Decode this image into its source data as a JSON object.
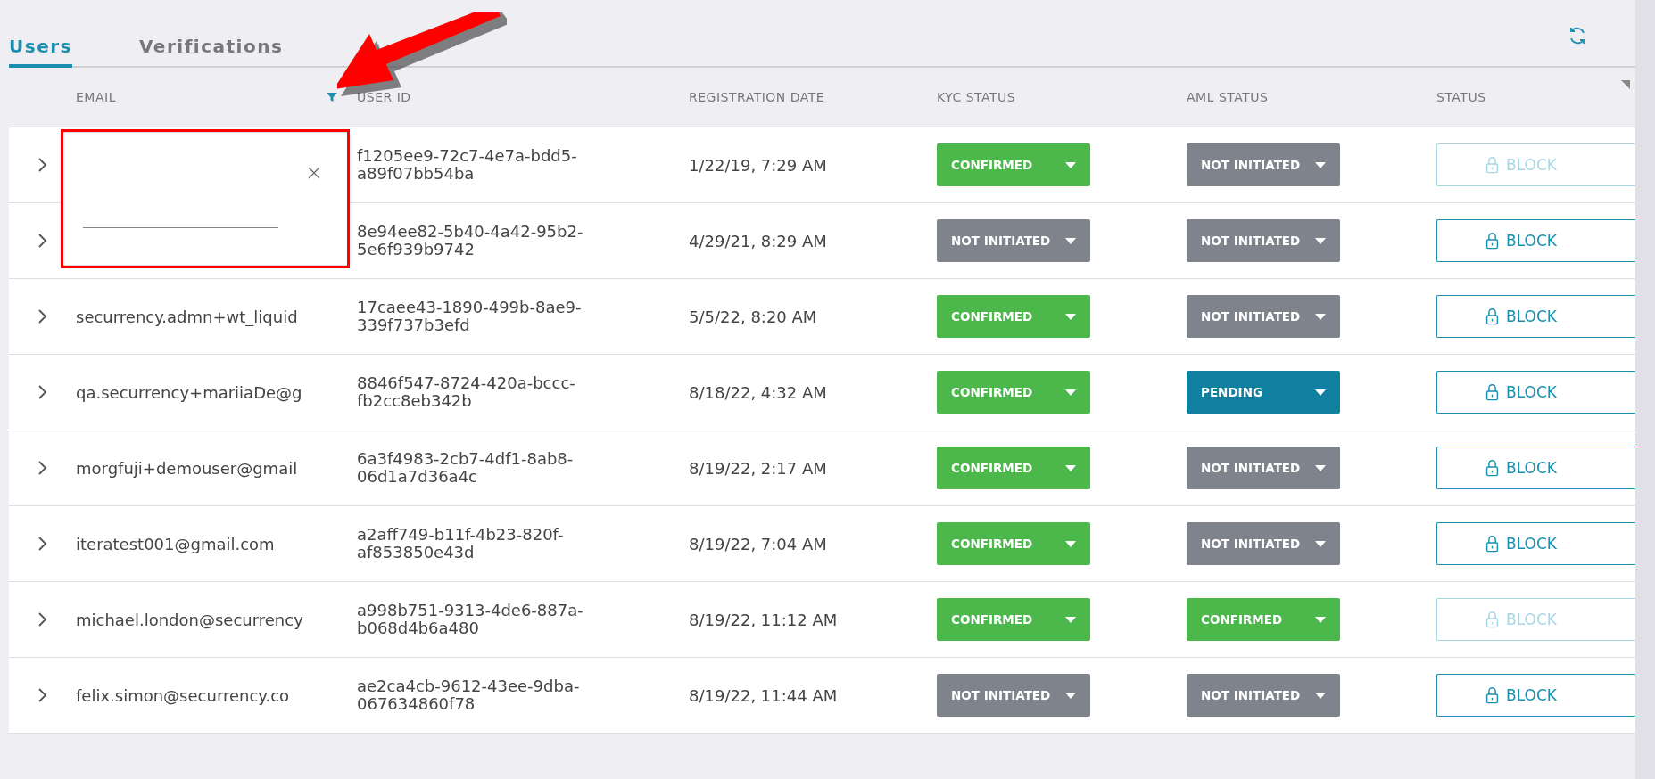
{
  "tabs": [
    {
      "label": "Users",
      "selected": true
    },
    {
      "label": "Verifications",
      "selected": false
    }
  ],
  "table": {
    "columns": [
      "EMAIL",
      "USER ID",
      "REGISTRATION DATE",
      "KYC STATUS",
      "AML STATUS",
      "STATUS"
    ],
    "rows": [
      {
        "email": "",
        "user_id": "f1205ee9-72c7-4e7a-bdd5-a89f07bb54ba",
        "registered": "1/22/19, 7:29 AM",
        "kyc": {
          "label": "CONFIRMED",
          "kind": "confirmed"
        },
        "aml": {
          "label": "NOT INITIATED",
          "kind": "not_initiated"
        },
        "action": {
          "label": "BLOCK",
          "disabled": true
        }
      },
      {
        "email": "",
        "user_id": "8e94ee82-5b40-4a42-95b2-5e6f939b9742",
        "registered": "4/29/21, 8:29 AM",
        "kyc": {
          "label": "NOT INITIATED",
          "kind": "not_initiated"
        },
        "aml": {
          "label": "NOT INITIATED",
          "kind": "not_initiated"
        },
        "action": {
          "label": "BLOCK",
          "disabled": false
        }
      },
      {
        "email": "securrency.admn+wt_liquid",
        "user_id": "17caee43-1890-499b-8ae9-339f737b3efd",
        "registered": "5/5/22, 8:20 AM",
        "kyc": {
          "label": "CONFIRMED",
          "kind": "confirmed"
        },
        "aml": {
          "label": "NOT INITIATED",
          "kind": "not_initiated"
        },
        "action": {
          "label": "BLOCK",
          "disabled": false
        }
      },
      {
        "email": "qa.securrency+mariiaDe@g",
        "user_id": "8846f547-8724-420a-bccc-fb2cc8eb342b",
        "registered": "8/18/22, 4:32 AM",
        "kyc": {
          "label": "CONFIRMED",
          "kind": "confirmed"
        },
        "aml": {
          "label": "PENDING",
          "kind": "pending"
        },
        "action": {
          "label": "BLOCK",
          "disabled": false
        }
      },
      {
        "email": "morgfuji+demouser@gmail",
        "user_id": "6a3f4983-2cb7-4df1-8ab8-06d1a7d36a4c",
        "registered": "8/19/22, 2:17 AM",
        "kyc": {
          "label": "CONFIRMED",
          "kind": "confirmed"
        },
        "aml": {
          "label": "NOT INITIATED",
          "kind": "not_initiated"
        },
        "action": {
          "label": "BLOCK",
          "disabled": false
        }
      },
      {
        "email": "iteratest001@gmail.com",
        "user_id": "a2aff749-b11f-4b23-820f-af853850e43d",
        "registered": "8/19/22, 7:04 AM",
        "kyc": {
          "label": "CONFIRMED",
          "kind": "confirmed"
        },
        "aml": {
          "label": "NOT INITIATED",
          "kind": "not_initiated"
        },
        "action": {
          "label": "BLOCK",
          "disabled": false
        }
      },
      {
        "email": "michael.london@securrency",
        "user_id": "a998b751-9313-4de6-887a-b068d4b6a480",
        "registered": "8/19/22, 11:12 AM",
        "kyc": {
          "label": "CONFIRMED",
          "kind": "confirmed"
        },
        "aml": {
          "label": "CONFIRMED",
          "kind": "confirmed"
        },
        "action": {
          "label": "BLOCK",
          "disabled": true
        }
      },
      {
        "email": "felix.simon@securrency.co",
        "user_id": "ae2ca4cb-9612-43ee-9dba-067634860f78",
        "registered": "8/19/22, 11:44 AM",
        "kyc": {
          "label": "NOT INITIATED",
          "kind": "not_initiated"
        },
        "aml": {
          "label": "NOT INITIATED",
          "kind": "not_initiated"
        },
        "action": {
          "label": "BLOCK",
          "disabled": false
        }
      }
    ]
  },
  "email_filter": {
    "open": true
  }
}
